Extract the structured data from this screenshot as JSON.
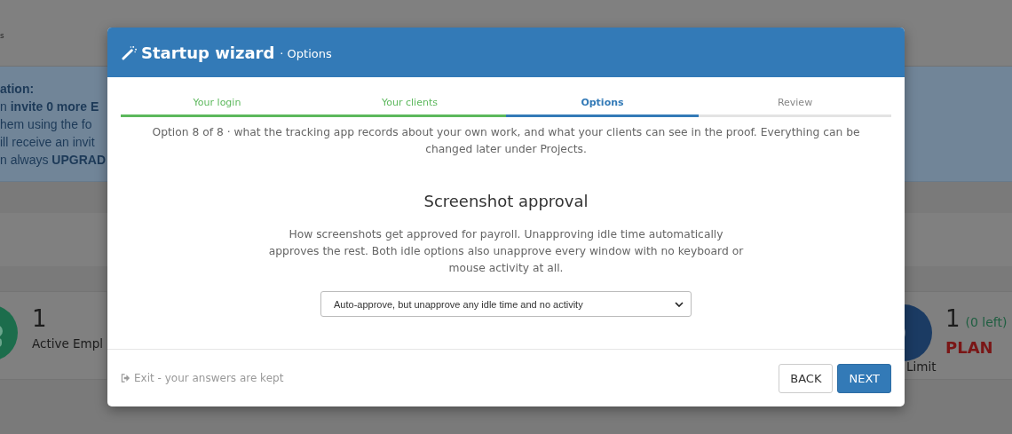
{
  "background_page": {
    "top_bar_text": "s",
    "notice": {
      "title": "ation:",
      "lines": [
        "n **invite 0 more E**",
        "hem using the fo",
        "ill receive an invit",
        "n always **UPGRAD**"
      ]
    },
    "cards": [
      {
        "kind": "employees",
        "value": "1",
        "label": "Active Empl"
      },
      {
        "kind": "limit",
        "value": "1",
        "remaining": "(0 left)",
        "plan": "PLAN",
        "label": "Limit"
      }
    ]
  },
  "dialog": {
    "title": "Startup wizard",
    "subtitle": "· Options",
    "steps": [
      {
        "label": "Your login",
        "complete": true,
        "selected": false
      },
      {
        "label": "Your clients",
        "complete": true,
        "selected": false
      },
      {
        "label": "Options",
        "complete": false,
        "selected": true
      },
      {
        "label": "Review",
        "complete": false,
        "selected": false
      }
    ],
    "intro": "Option 8 of 8 · what the tracking app records about your own work, and what your clients can see in the proof. Everything can be changed later under Projects.",
    "section_title": "Screenshot approval",
    "description": "How screenshots get approved for payroll. Unapproving idle time automatically approves the rest. Both idle options also unapprove every window with no keyboard or mouse activity at all.",
    "approval_select": {
      "value": "Auto-approve, but unapprove any idle time and no activity"
    },
    "exit_link": "Exit - your answers are kept",
    "buttons": [
      {
        "kind": "secondary",
        "label": "BACK"
      },
      {
        "kind": "primary",
        "label": "NEXT"
      }
    ]
  }
}
